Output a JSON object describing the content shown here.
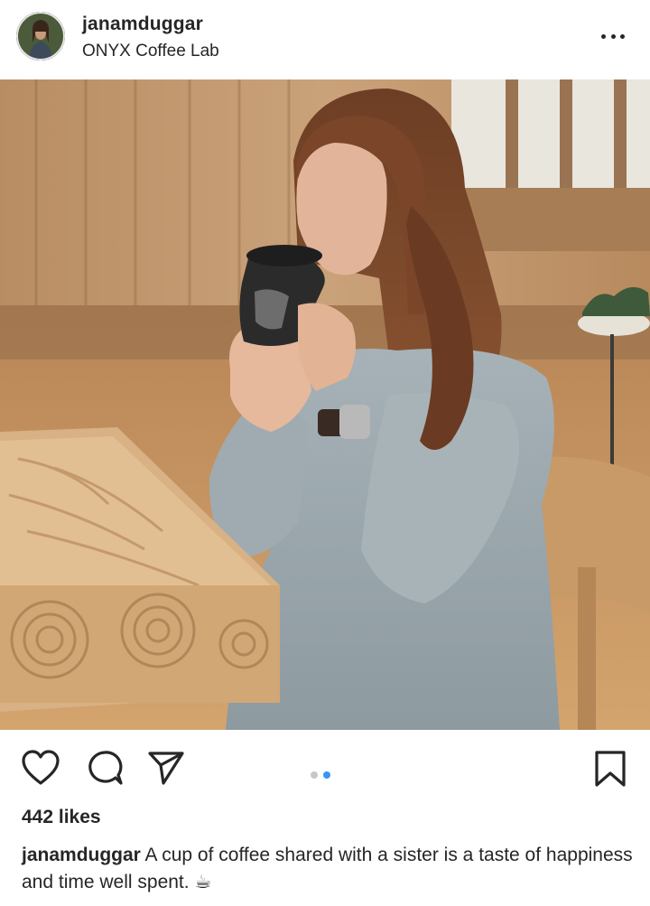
{
  "post": {
    "username": "janamduggar",
    "location": "ONYX Coffee Lab",
    "likes_text": "442 likes",
    "caption_username": "janamduggar",
    "caption_text": "A cup of coffee shared with a sister is a taste of happiness and time well spent.",
    "caption_emoji": "☕"
  },
  "carousel": {
    "count": 2,
    "active_index": 1
  },
  "colors": {
    "accent_blue": "#3897f0",
    "text": "#262626",
    "dot_inactive": "#c7c7c7"
  },
  "icons": [
    "more-icon",
    "heart-icon",
    "comment-icon",
    "share-icon",
    "bookmark-icon"
  ]
}
